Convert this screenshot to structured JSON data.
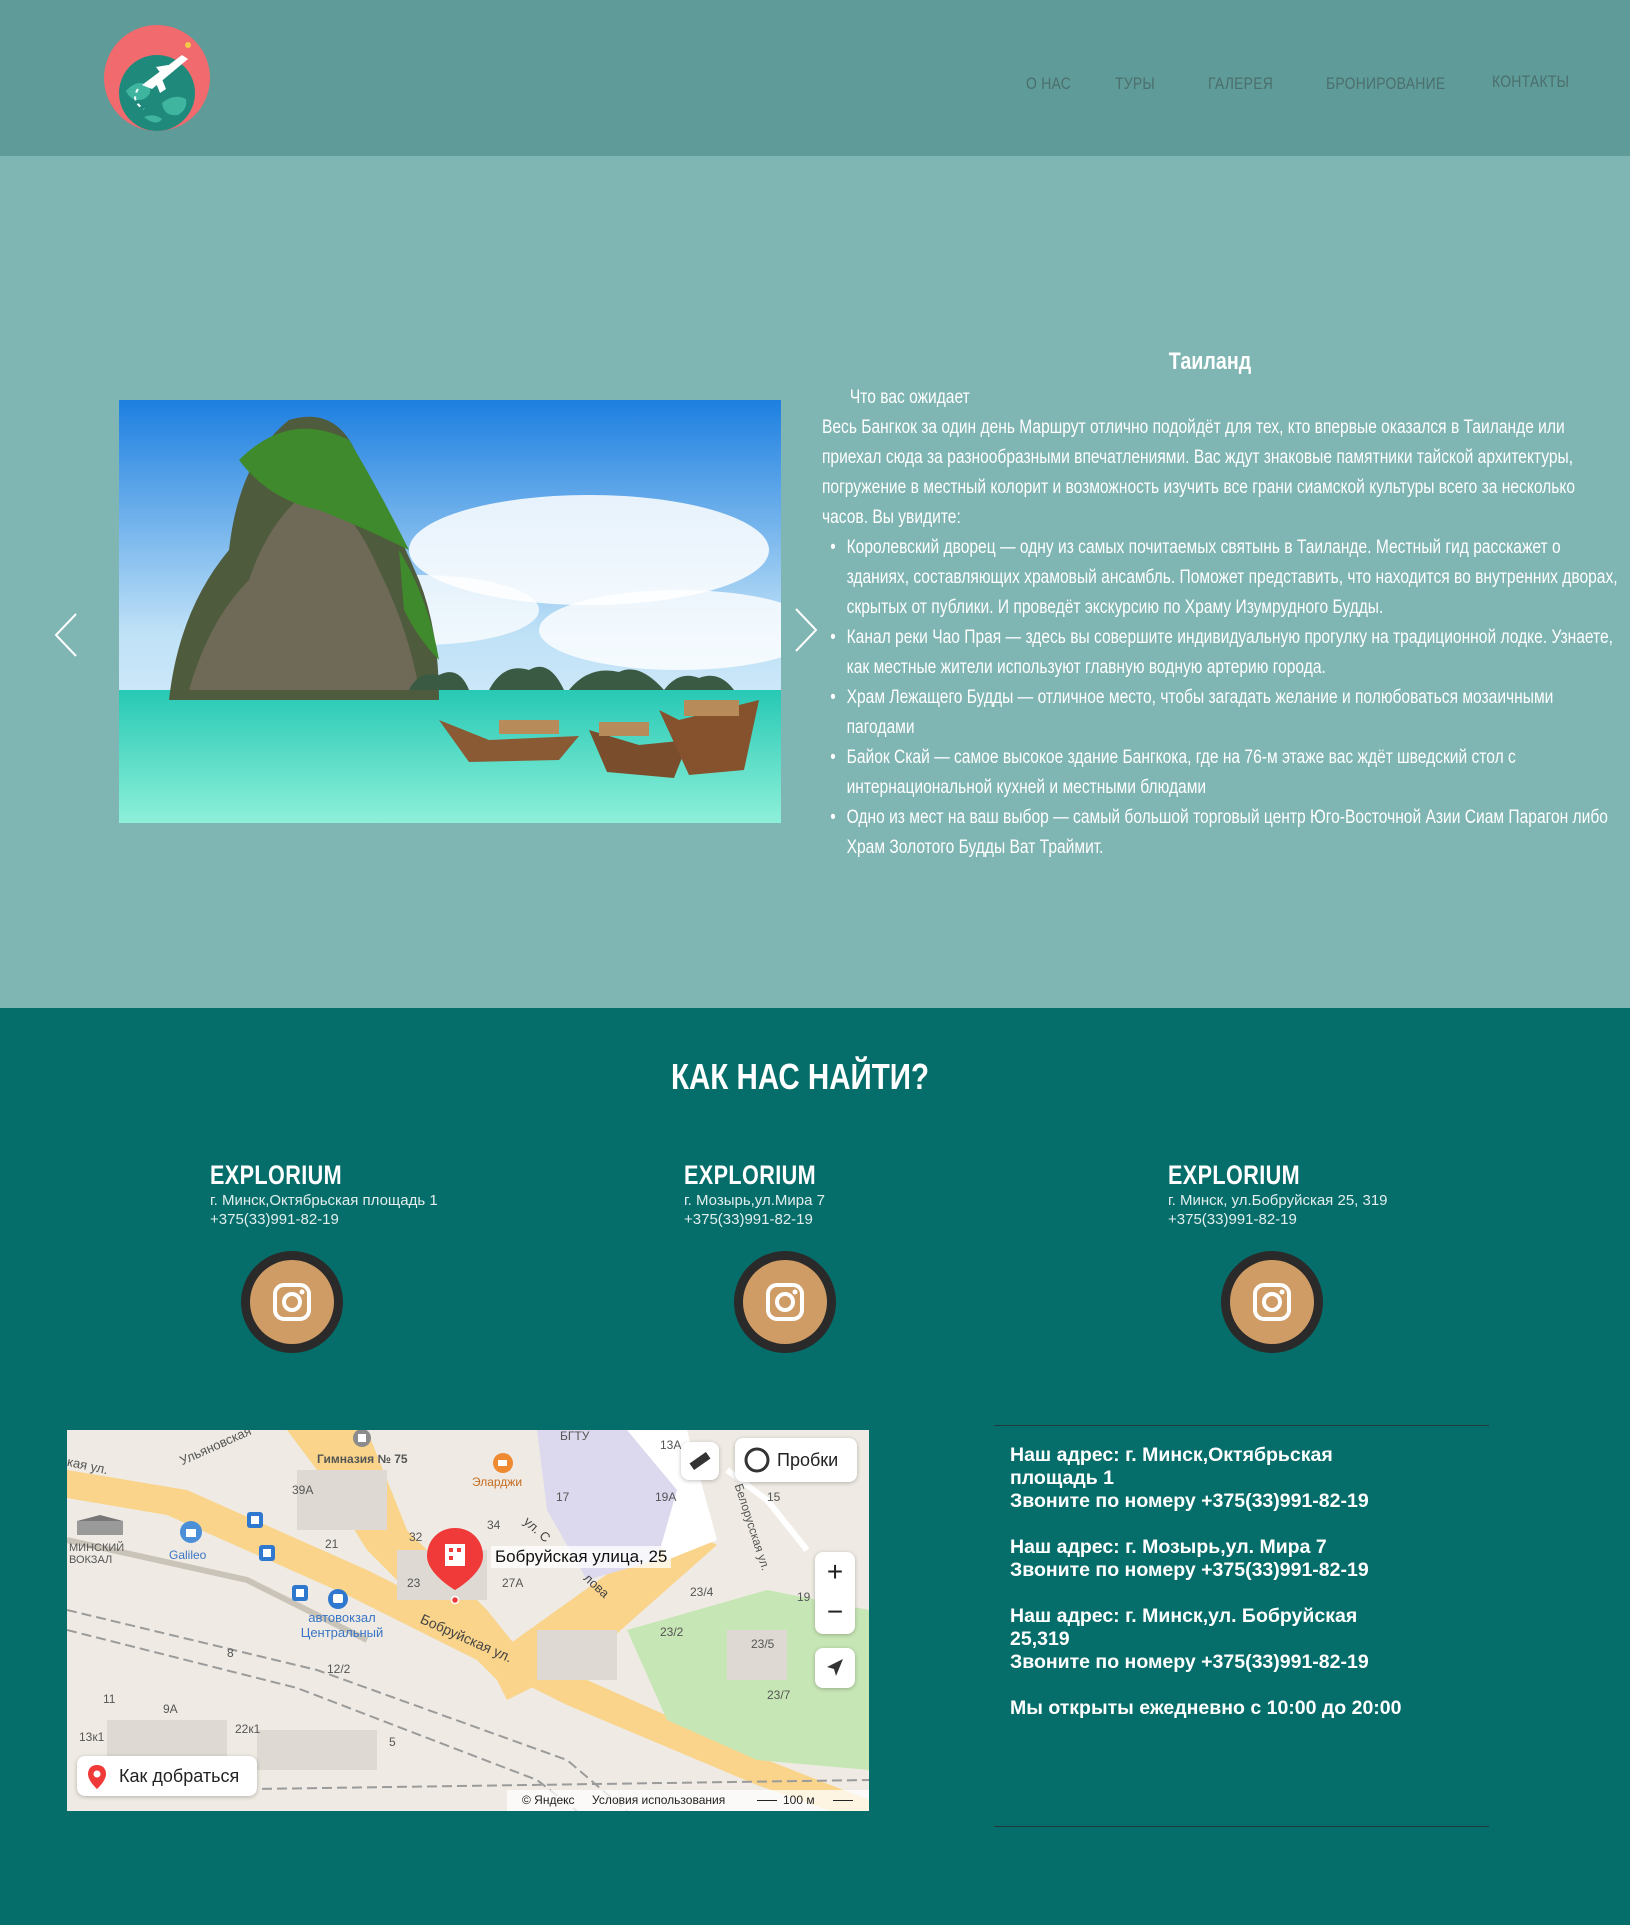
{
  "nav": {
    "about": "О НАС",
    "tours": "ТУРЫ",
    "gallery": "ГАЛЕРЕЯ",
    "booking": "БРОНИРОВАНИЕ",
    "contacts": "КОНТАКТЫ"
  },
  "tour": {
    "title": "Таиланд",
    "expect": "Что вас ожидает",
    "intro": "Весь Бангкок за один день Маршрут отлично подойдёт для тех, кто впервые оказался в Таиланде или приехал сюда за разнообразными впечатлениями. Вас ждут знаковые памятники тайской архитектуры, погружение в местный колорит и возможность изучить все грани сиамской культуры всего за несколько часов. Вы увидите:",
    "items": [
      "Королевский дворец — одну из самых почитаемых святынь в Таиланде. Местный гид расскажет о зданиях, составляющих храмовый ансамбль. Поможет представить, что находится во внутренних дворах, скрытых от публики. И проведёт экскурсию по Храму Изумрудного Будды.",
      "Канал реки Чао Прая — здесь вы совершите индивидуальную прогулку на традиционной лодке. Узнаете, как местные жители используют главную водную артерию города.",
      "Храм Лежащего Будды — отличное место, чтобы загадать желание и полюбоваться мозаичными пагодами",
      "Байок Скай — самое высокое здание Бангкока, где на 76-м этаже вас ждёт шведский стол с интернациональной кухней и местными блюдами",
      "Одно из мест на ваш выбор — самый большой торговый центр Юго-Восточной Азии Сиам Парагон либо Храм Золотого Будды Ват Траймит."
    ]
  },
  "find_us": {
    "title": "КАК НАС НАЙТИ?",
    "offices": [
      {
        "brand": "EXPLORIUM",
        "address": "г. Минск,Октябрьская площадь 1",
        "phone": "+375(33)991-82-19"
      },
      {
        "brand": "EXPLORIUM",
        "address": "г. Мозырь,ул.Мира 7",
        "phone": "+375(33)991-82-19"
      },
      {
        "brand": "EXPLORIUM",
        "address": "г. Минск, ул.Бобруйская 25, 319",
        "phone": "+375(33)991-82-19"
      }
    ]
  },
  "map": {
    "traffic_label": "Пробки",
    "route_label": "Как добраться",
    "pin_label": "Бобруйская улица, 25",
    "copyright": "© Яндекс",
    "terms": "Условия использования",
    "scale": "100 м",
    "labels": {
      "gymnasium": "Гимназия № 75",
      "bgtu": "БГТУ",
      "elarzhi": "Эларджи",
      "galileo": "Galileo",
      "minsk_station": "МИНСКИЙ ВОКЗАЛ",
      "bus_station": "автовокзал Центральный",
      "bobruiskaya_street": "Бобруйская ул.",
      "belorusskaya": "Белорусская ул.",
      "ulyanovskaya": "Ульяновская",
      "ul_s": "ул. С",
      "lova": "лова",
      "kaya": "кая ул."
    },
    "house_numbers": [
      "39А",
      "21",
      "32",
      "34",
      "27А",
      "23",
      "17",
      "19А",
      "13А",
      "15",
      "23/4",
      "19",
      "23/2",
      "23/5",
      "23/7",
      "12/2",
      "8",
      "11",
      "9А",
      "13к1",
      "22к1",
      "5"
    ]
  },
  "info": {
    "addr1": "Наш адрес: г. Минск,Октябрьская площадь 1",
    "phone1": "Звоните по номеру +375(33)991-82-19",
    "addr2": "Наш адрес: г. Мозырь,ул. Мира 7",
    "phone2": "Звоните по номеру +375(33)991-82-19",
    "addr3": "Наш адрес: г. Минск,ул. Бобруйская 25,319",
    "phone3": "Звоните по номеру +375(33)991-82-19",
    "hours": "Мы открыты ежедневно с 10:00 до 20:00"
  },
  "colors": {
    "header": "#5f9b98",
    "hero": "#7fb5b2",
    "footer": "#066e6a",
    "instagram": "#cf9c66"
  }
}
